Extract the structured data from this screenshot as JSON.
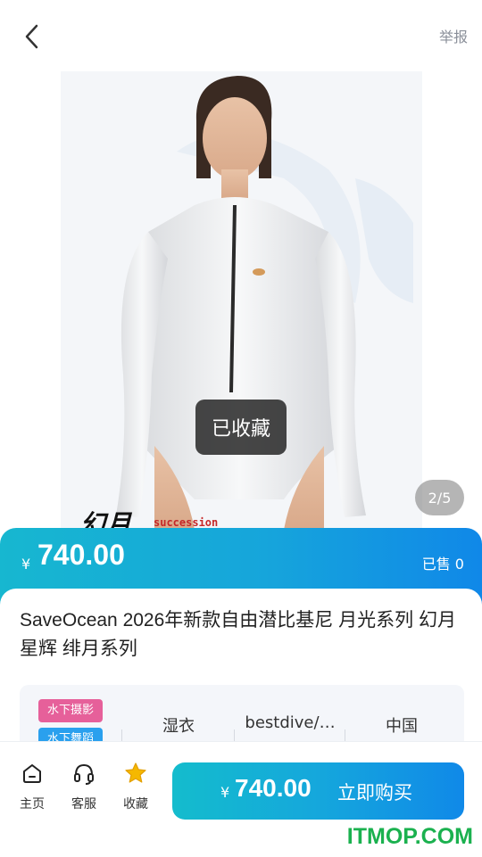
{
  "header": {
    "report_label": "举报"
  },
  "gallery": {
    "watermark_text": "幻月",
    "watermark_sub": "succession",
    "toast_text": "已收藏",
    "page_indicator": "2/5"
  },
  "price": {
    "currency": "¥",
    "amount": "740.00",
    "sold_label": "已售 0"
  },
  "product": {
    "title": "SaveOcean 2026年新款自由潜比基尼 月光系列 幻月 星辉 绯月系列",
    "tags": [
      "水下摄影",
      "水下舞蹈"
    ],
    "specs": [
      "湿衣",
      "bestdive/…",
      "中国"
    ]
  },
  "bottom_nav": {
    "items": [
      {
        "label": "主页",
        "icon": "home-icon"
      },
      {
        "label": "客服",
        "icon": "headset-icon"
      },
      {
        "label": "收藏",
        "icon": "star-icon"
      }
    ],
    "buy_button": {
      "currency": "¥",
      "amount": "740.00",
      "label": "立即购买"
    }
  },
  "footer_logo": "ITMOP.COM",
  "colors": {
    "accent": "#1aa6da",
    "star": "#f5b800",
    "tag_pink": "#e6609a",
    "tag_blue": "#2aa0ee"
  }
}
